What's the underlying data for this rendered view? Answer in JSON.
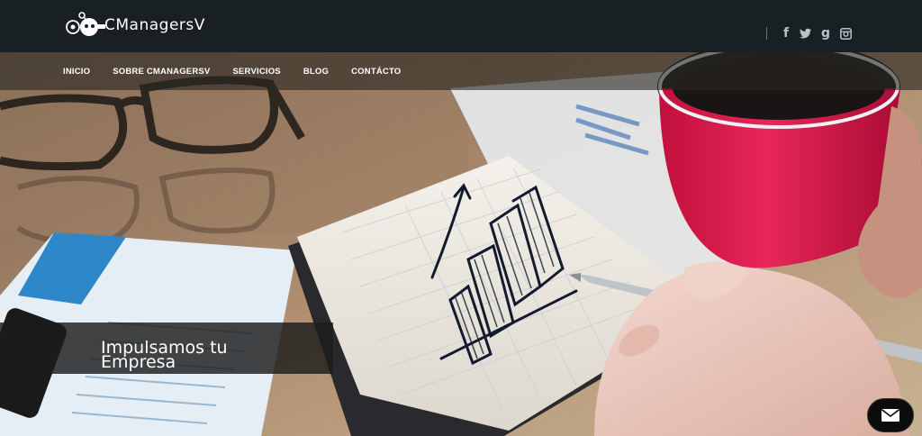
{
  "brand": {
    "name": "CManagersV"
  },
  "social": {
    "icons": [
      "facebook-icon",
      "twitter-icon",
      "google-plus-icon",
      "instagram-icon"
    ],
    "glyphs": [
      "f",
      "t",
      "g",
      "◙"
    ]
  },
  "nav": {
    "items": [
      {
        "label": "INICIO"
      },
      {
        "label": "SOBRE CMANAGERSV"
      },
      {
        "label": "SERVICIOS"
      },
      {
        "label": "BLOG"
      },
      {
        "label": "CONTÁCTO"
      }
    ]
  },
  "hero": {
    "line1": "Impulsamos tu",
    "line2": "Empresa"
  },
  "contact": {
    "icon": "mail-icon"
  },
  "colors": {
    "topbar": "#182024",
    "cup": "#d8184a",
    "nav_overlay": "rgba(40,38,34,0.62)"
  }
}
